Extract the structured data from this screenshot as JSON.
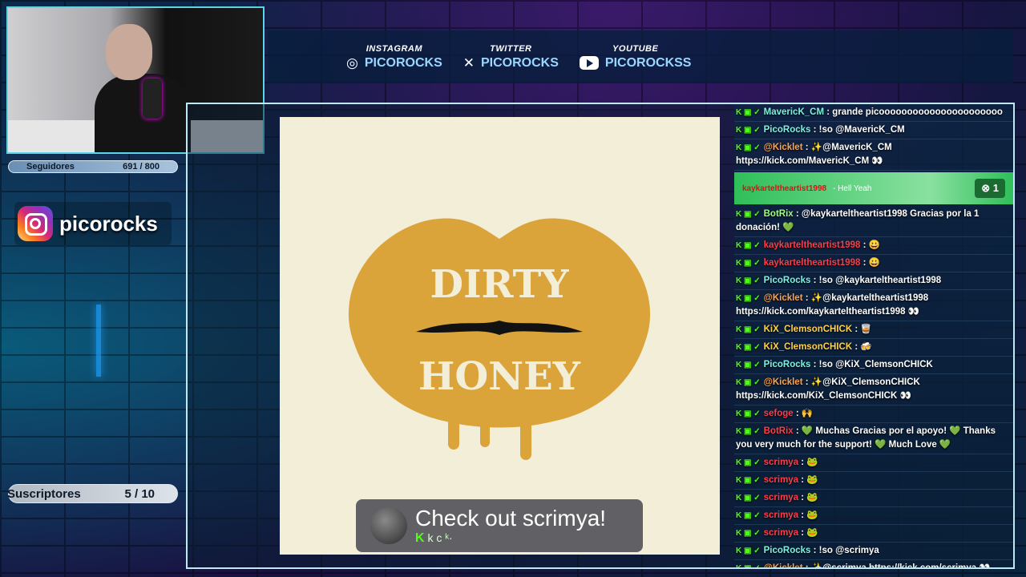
{
  "social": [
    {
      "label": "INSTAGRAM",
      "handle": "PICOROCKS",
      "icon": "instagram-icon"
    },
    {
      "label": "TWITTER",
      "handle": "PICOROCKS",
      "icon": "x-icon"
    },
    {
      "label": "YOUTUBE",
      "handle": "PICOROCKSS",
      "icon": "youtube-icon"
    }
  ],
  "followers": {
    "label": "Seguidores",
    "value": "691 / 800",
    "progress": 0.86
  },
  "subscribers": {
    "label": "Suscriptores",
    "value": "5 / 10",
    "progress": 0.5
  },
  "instagram_name": "picorocks",
  "album": {
    "logo_text": "DIRTY HONEY"
  },
  "toast": {
    "title": "Check out scrimya!",
    "brand_k": "K",
    "brand_rest": "k c ᵏ·"
  },
  "donation": {
    "user": "kaykarteltheartist1998",
    "message": "- Hell Yeah",
    "amount": "1"
  },
  "chat": [
    {
      "user": "MavericK_CM",
      "cls": "u-cyan",
      "text": ": grande picoooooooooooooooooooooo"
    },
    {
      "user": "PicoRocks",
      "cls": "u-cyan",
      "text": ": !so @MavericK_CM"
    },
    {
      "user": "@Kicklet",
      "cls": "u-orange",
      "text": ": ✨@MavericK_CM https://kick.com/MavericK_CM 👀"
    },
    {
      "user": "BotRix",
      "cls": "u-green",
      "text": ": @kaykarteltheartist1998 Gracias por la 1 donación! 💚"
    },
    {
      "user": "kaykarteltheartist1998",
      "cls": "u-red",
      "text": ": 😀"
    },
    {
      "user": "kaykarteltheartist1998",
      "cls": "u-red",
      "text": ": 😀"
    },
    {
      "user": "PicoRocks",
      "cls": "u-cyan",
      "text": ": !so @kaykarteltheartist1998"
    },
    {
      "user": "@Kicklet",
      "cls": "u-orange",
      "text": ": ✨@kaykarteltheartist1998 https://kick.com/kaykarteltheartist1998 👀"
    },
    {
      "user": "KiX_ClemsonCHICK",
      "cls": "u-gold",
      "text": ": 🥃"
    },
    {
      "user": "KiX_ClemsonCHICK",
      "cls": "u-gold",
      "text": ": 🍻"
    },
    {
      "user": "PicoRocks",
      "cls": "u-cyan",
      "text": ": !so @KiX_ClemsonCHICK"
    },
    {
      "user": "@Kicklet",
      "cls": "u-orange",
      "text": ": ✨@KiX_ClemsonCHICK https://kick.com/KiX_ClemsonCHICK 👀"
    },
    {
      "user": "sefoge",
      "cls": "u-red",
      "text": ": 🙌"
    },
    {
      "user": "BotRix",
      "cls": "u-red",
      "text": ": 💚 Muchas Gracias por el apoyo! 💚 Thanks you very much for the support! 💚 Much Love 💚"
    },
    {
      "user": "scrimya",
      "cls": "u-red",
      "text": ": 🐸"
    },
    {
      "user": "scrimya",
      "cls": "u-red",
      "text": ": 🐸"
    },
    {
      "user": "scrimya",
      "cls": "u-red",
      "text": ": 🐸"
    },
    {
      "user": "scrimya",
      "cls": "u-red",
      "text": ": 🐸"
    },
    {
      "user": "scrimya",
      "cls": "u-red",
      "text": ": 🐸"
    },
    {
      "user": "PicoRocks",
      "cls": "u-cyan",
      "text": ": !so @scrimya"
    },
    {
      "user": "@Kicklet",
      "cls": "u-orange",
      "text": ": ✨@scrimya https://kick.com/scrimya 👀"
    }
  ]
}
